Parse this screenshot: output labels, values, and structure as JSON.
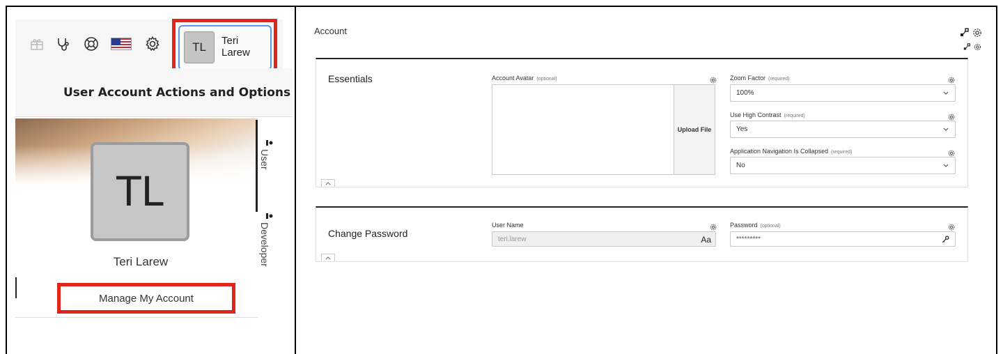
{
  "toolbar": {
    "icons": [
      "gift-icon",
      "stethoscope-icon",
      "lifebuoy-icon",
      "us-flag-icon",
      "gear-icon"
    ]
  },
  "user_button": {
    "initials": "TL",
    "first_name": "Teri",
    "last_name": "Larew"
  },
  "menu": {
    "header": "User Account Actions and Options",
    "avatar_initials": "TL",
    "full_name": "Teri Larew",
    "manage_label": "Manage My Account",
    "tabs": [
      {
        "label": "User",
        "active": true
      },
      {
        "label": "Developer",
        "active": false
      }
    ]
  },
  "account": {
    "title": "Account",
    "essentials": {
      "title": "Essentials",
      "avatar_label": "Account Avatar",
      "avatar_hint": "(optional)",
      "upload_label": "Upload File",
      "zoom_label": "Zoom Factor",
      "zoom_hint": "(required)",
      "zoom_value": "100%",
      "contrast_label": "Use High Contrast",
      "contrast_hint": "(required)",
      "contrast_value": "Yes",
      "nav_label": "Application Navigation Is Collapsed",
      "nav_hint": "(required)",
      "nav_value": "No"
    },
    "password": {
      "title": "Change Password",
      "username_label": "User Name",
      "username_value": "teri.larew",
      "username_suffix": "Aa",
      "password_label": "Password",
      "password_hint": "(optional)",
      "password_value": "*********"
    }
  },
  "colors": {
    "highlight": "#e3241b",
    "focus_ring": "#5a97ea",
    "avatar_bg": "#c6c6c6"
  }
}
